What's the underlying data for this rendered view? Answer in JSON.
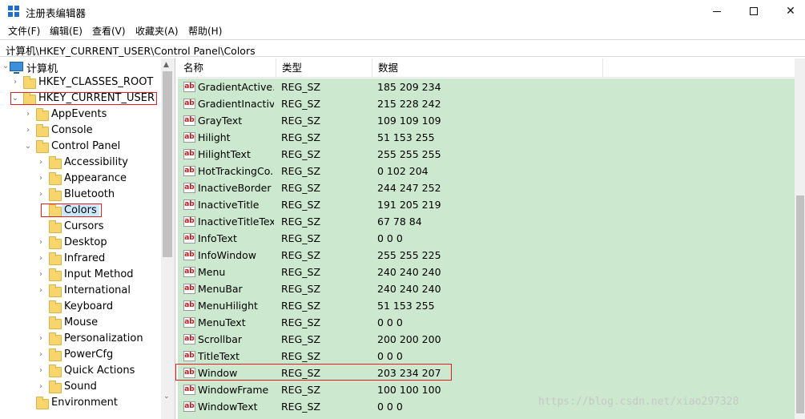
{
  "window": {
    "title": "注册表编辑器",
    "controls": {
      "minimize": "minimize-icon",
      "maximize": "maximize-icon",
      "close": "close-icon"
    }
  },
  "menu": [
    "文件(F)",
    "编辑(E)",
    "查看(V)",
    "收藏夹(A)",
    "帮助(H)"
  ],
  "address": "计算机\\HKEY_CURRENT_USER\\Control Panel\\Colors",
  "tree": {
    "root": "计算机",
    "items": [
      {
        "label": "HKEY_CLASSES_ROOT"
      },
      {
        "label": "HKEY_CURRENT_USER"
      },
      {
        "label": "AppEvents"
      },
      {
        "label": "Console"
      },
      {
        "label": "Control Panel"
      },
      {
        "label": "Accessibility"
      },
      {
        "label": "Appearance"
      },
      {
        "label": "Bluetooth"
      },
      {
        "label": "Colors"
      },
      {
        "label": "Cursors"
      },
      {
        "label": "Desktop"
      },
      {
        "label": "Infrared"
      },
      {
        "label": "Input Method"
      },
      {
        "label": "International"
      },
      {
        "label": "Keyboard"
      },
      {
        "label": "Mouse"
      },
      {
        "label": "Personalization"
      },
      {
        "label": "PowerCfg"
      },
      {
        "label": "Quick Actions"
      },
      {
        "label": "Sound"
      },
      {
        "label": "Environment"
      }
    ],
    "selected": "Colors"
  },
  "list": {
    "columns": [
      "名称",
      "类型",
      "数据"
    ],
    "rows": [
      {
        "name": "GradientActive...",
        "type": "REG_SZ",
        "data": "185 209 234"
      },
      {
        "name": "GradientInactiv...",
        "type": "REG_SZ",
        "data": "215 228 242"
      },
      {
        "name": "GrayText",
        "type": "REG_SZ",
        "data": "109 109 109"
      },
      {
        "name": "Hilight",
        "type": "REG_SZ",
        "data": "51 153 255"
      },
      {
        "name": "HilightText",
        "type": "REG_SZ",
        "data": "255 255 255"
      },
      {
        "name": "HotTrackingCo...",
        "type": "REG_SZ",
        "data": "0 102 204"
      },
      {
        "name": "InactiveBorder",
        "type": "REG_SZ",
        "data": "244 247 252"
      },
      {
        "name": "InactiveTitle",
        "type": "REG_SZ",
        "data": "191 205 219"
      },
      {
        "name": "InactiveTitleText",
        "type": "REG_SZ",
        "data": "67 78 84"
      },
      {
        "name": "InfoText",
        "type": "REG_SZ",
        "data": "0 0 0"
      },
      {
        "name": "InfoWindow",
        "type": "REG_SZ",
        "data": "255 255 225"
      },
      {
        "name": "Menu",
        "type": "REG_SZ",
        "data": "240 240 240"
      },
      {
        "name": "MenuBar",
        "type": "REG_SZ",
        "data": "240 240 240"
      },
      {
        "name": "MenuHilight",
        "type": "REG_SZ",
        "data": "51 153 255"
      },
      {
        "name": "MenuText",
        "type": "REG_SZ",
        "data": "0 0 0"
      },
      {
        "name": "Scrollbar",
        "type": "REG_SZ",
        "data": "200 200 200"
      },
      {
        "name": "TitleText",
        "type": "REG_SZ",
        "data": "0 0 0"
      },
      {
        "name": "Window",
        "type": "REG_SZ",
        "data": "203 234 207"
      },
      {
        "name": "WindowFrame",
        "type": "REG_SZ",
        "data": "100 100 100"
      },
      {
        "name": "WindowText",
        "type": "REG_SZ",
        "data": "0 0 0"
      }
    ],
    "highlighted_row": "Window"
  },
  "watermark": "https://blog.csdn.net/xiao297328",
  "colors": {
    "list_background": "#cce8cf",
    "annotation_box": "#e02020",
    "folder": "#f7d46c"
  }
}
